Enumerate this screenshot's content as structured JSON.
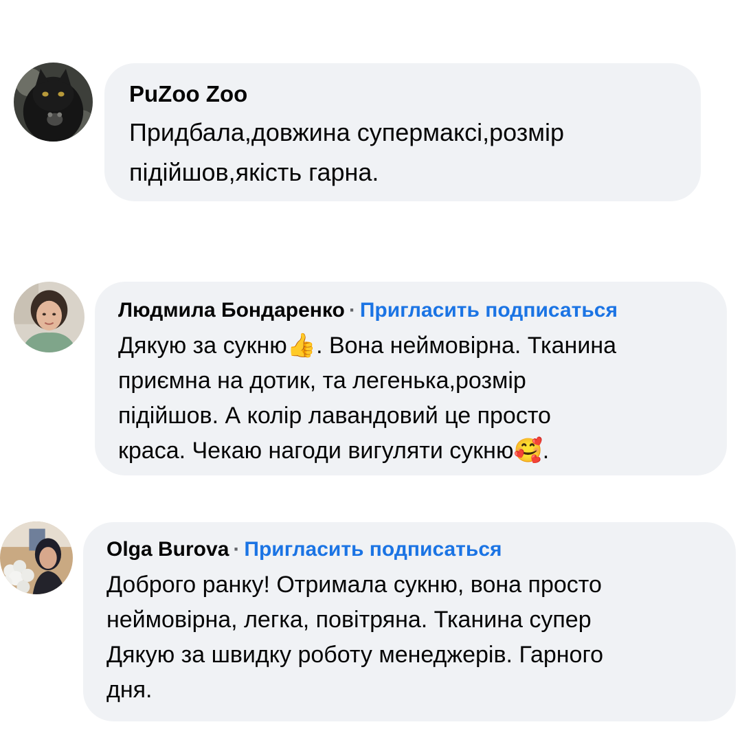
{
  "comments": [
    {
      "author": "PuZoo Zoo",
      "avatar_icon": "black-cat-avatar",
      "lines": [
        "Придбала,довжина супермаксі,розмір",
        "підійшов,якість гарна."
      ]
    },
    {
      "author": "Людмила Бондаренко",
      "separator": "·",
      "invite": "Пригласить подписаться",
      "avatar_icon": "woman-avatar",
      "lines": [
        "Дякую за сукню👍. Вона неймовірна. Тканина",
        "приємна на дотик, та легенька,розмір",
        "підійшов. А колір лавандовий це просто",
        "краса. Чекаю нагоди вигуляти сукню🥰."
      ]
    },
    {
      "author": "Olga Burova",
      "separator": "·",
      "invite": "Пригласить подписаться",
      "avatar_icon": "woman-with-flowers-avatar",
      "lines": [
        "Доброго ранку! Отримала сукню, вона просто",
        "неймовірна,  легка, повітряна. Тканина супер",
        "Дякую за швидку роботу менеджерів. Гарного",
        "дня."
      ]
    }
  ],
  "colors": {
    "bubble_bg": "#f0f2f5",
    "link": "#1b74e4",
    "separator": "#65676b",
    "text": "#050505"
  }
}
